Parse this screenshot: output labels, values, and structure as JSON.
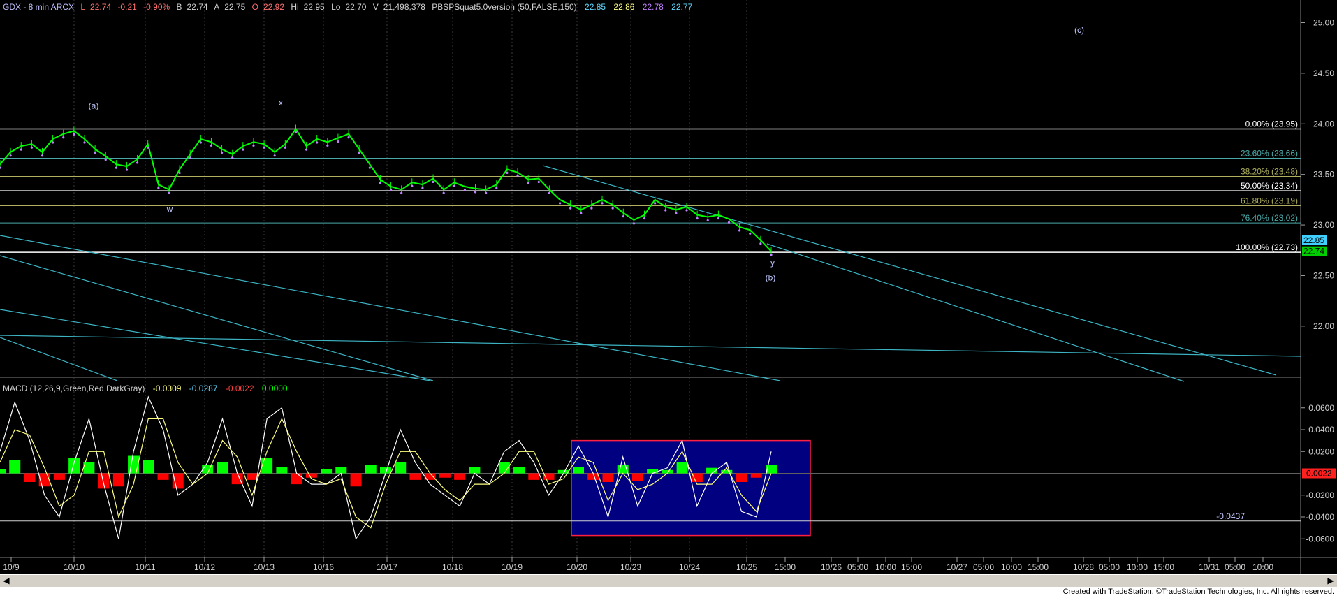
{
  "header": {
    "symbol_line": "GDX - 8 min  ARCX",
    "last": "L=22.74",
    "change": "-0.21",
    "change_pct": "-0.90%",
    "bid": "B=22.74",
    "ask": "A=22.75",
    "open": "O=22.92",
    "high": "Hi=22.95",
    "low": "Lo=22.70",
    "volume": "V=21,498,378",
    "study": "PBSPSquat5.0version (50,FALSE,150)",
    "study_values": [
      "22.85",
      "22.86",
      "22.78",
      "22.77"
    ]
  },
  "colors": {
    "background": "#000000",
    "price": "#00ff00",
    "trendline": "#3cb4c4",
    "fib_white": "#ffffff",
    "fib_teal": "#4aa8a8",
    "fib_olive": "#b0b060",
    "macd_line": "#ffffff",
    "signal_line": "#ffff80",
    "hist_pos": "#00ff00",
    "hist_neg": "#ff0000",
    "box_fill": "#000080",
    "box_border": "#ff2040"
  },
  "chart_data": [
    {
      "type": "line",
      "title": "GDX - 8 min",
      "ylim": [
        21.55,
        25.1
      ],
      "y_ticks": [
        "25.00",
        "24.50",
        "24.00",
        "23.50",
        "23.00",
        "22.50",
        "22.00"
      ],
      "y_tick_values": [
        25.0,
        24.5,
        24.0,
        23.5,
        23.0,
        22.5,
        22.0
      ],
      "x_labels": [
        "10/9",
        "10/10",
        "10/11",
        "10/12",
        "10/13",
        "10/16",
        "10/17",
        "10/18",
        "10/19",
        "10/20",
        "10/23",
        "10/24",
        "10/25",
        "15:00",
        "10/26",
        "05:00",
        "10:00",
        "15:00",
        "10/27",
        "05:00",
        "10:00",
        "15:00",
        "10/28",
        "05:00",
        "10:00",
        "15:00",
        "10/31",
        "05:00",
        "10:00"
      ],
      "series": [
        {
          "values": [
            23.6,
            23.72,
            23.78,
            23.8,
            23.72,
            23.85,
            23.9,
            23.93,
            23.85,
            23.75,
            23.68,
            23.6,
            23.58,
            23.65,
            23.8,
            23.4,
            23.35,
            23.55,
            23.7,
            23.85,
            23.82,
            23.75,
            23.7,
            23.78,
            23.82,
            23.8,
            23.72,
            23.8,
            23.95,
            23.78,
            23.85,
            23.82,
            23.86,
            23.9,
            23.75,
            23.6,
            23.45,
            23.38,
            23.35,
            23.42,
            23.4,
            23.46,
            23.35,
            23.42,
            23.38,
            23.36,
            23.35,
            23.4,
            23.55,
            23.52,
            23.45,
            23.46,
            23.35,
            23.25,
            23.2,
            23.15,
            23.2,
            23.25,
            23.2,
            23.12,
            23.05,
            23.1,
            23.25,
            23.18,
            23.15,
            23.18,
            23.1,
            23.08,
            23.1,
            23.06,
            22.98,
            22.95,
            22.85,
            22.74
          ]
        }
      ],
      "last_price_labels": [
        "22.85",
        "22.74"
      ],
      "fib_levels": [
        {
          "label": "0.00% (23.95)",
          "value": 23.95
        },
        {
          "label": "23.60% (23.66)",
          "value": 23.66
        },
        {
          "label": "38.20% (23.48)",
          "value": 23.48
        },
        {
          "label": "50.00% (23.34)",
          "value": 23.34
        },
        {
          "label": "61.80% (23.19)",
          "value": 23.19
        },
        {
          "label": "76.40% (23.02)",
          "value": 23.02
        },
        {
          "label": "100.00% (22.73)",
          "value": 22.73
        }
      ],
      "annotations": [
        "(a)",
        "x",
        "w",
        "y",
        "(b)",
        "(c)"
      ]
    },
    {
      "type": "area",
      "title": "MACD (12,26,9,Green,Red,DarkGray)",
      "legend_values": [
        "-0.0309",
        "-0.0287",
        "-0.0022",
        "0.0000"
      ],
      "ylim": [
        -0.072,
        0.072
      ],
      "y_ticks": [
        "0.0600",
        "0.0400",
        "0.0200",
        "-0.0200",
        "-0.0400",
        "-0.0600"
      ],
      "y_tick_values": [
        0.06,
        0.04,
        0.02,
        -0.02,
        -0.04,
        -0.06
      ],
      "zero_label": "-0.0022",
      "reference_line_label": "-0.0437",
      "reference_value": -0.0437,
      "macd": [
        0.02,
        0.065,
        0.03,
        -0.02,
        -0.04,
        0.01,
        0.05,
        -0.01,
        -0.06,
        0.02,
        0.07,
        0.04,
        -0.02,
        -0.01,
        0.01,
        0.05,
        0.0,
        -0.03,
        0.05,
        0.06,
        0.0,
        -0.01,
        -0.01,
        0.0,
        -0.06,
        -0.04,
        0.0,
        0.04,
        0.01,
        -0.01,
        -0.02,
        -0.03,
        0.0,
        -0.01,
        0.02,
        0.03,
        0.01,
        -0.02,
        0.0,
        0.025,
        0.0,
        -0.04,
        0.015,
        -0.03,
        0.0,
        0.005,
        0.03,
        -0.03,
        0.0,
        0.01,
        -0.035,
        -0.04,
        0.02
      ],
      "signal": [
        0.01,
        0.04,
        0.035,
        0.005,
        -0.03,
        -0.02,
        0.02,
        0.02,
        -0.04,
        -0.01,
        0.05,
        0.05,
        0.01,
        -0.01,
        0.0,
        0.03,
        0.015,
        -0.02,
        0.02,
        0.05,
        0.02,
        -0.005,
        -0.01,
        -0.005,
        -0.04,
        -0.05,
        -0.01,
        0.02,
        0.02,
        0.0,
        -0.015,
        -0.025,
        -0.01,
        -0.01,
        0.0,
        0.02,
        0.02,
        -0.01,
        -0.005,
        0.015,
        0.01,
        -0.025,
        0.0,
        -0.015,
        -0.01,
        0.0,
        0.02,
        -0.01,
        -0.01,
        0.005,
        -0.02,
        -0.035,
        0.0
      ],
      "histogram": [
        0.004,
        0.012,
        -0.008,
        -0.012,
        -0.006,
        0.014,
        0.01,
        -0.014,
        -0.012,
        0.016,
        0.012,
        -0.006,
        -0.014,
        0.0,
        0.008,
        0.01,
        -0.01,
        -0.006,
        0.014,
        0.006,
        -0.01,
        -0.004,
        0.004,
        0.006,
        -0.012,
        0.008,
        0.006,
        0.01,
        -0.006,
        -0.006,
        -0.004,
        -0.006,
        0.006,
        0.0,
        0.01,
        0.006,
        -0.006,
        -0.006,
        0.003,
        0.006,
        -0.006,
        -0.008,
        0.008,
        -0.007,
        0.004,
        0.003,
        0.01,
        -0.008,
        0.005,
        0.003,
        -0.008,
        -0.004,
        0.008
      ]
    }
  ],
  "scrollbar": {
    "left_arrow": "◀",
    "right_arrow": "▶"
  },
  "footer": {
    "text": "Created with TradeStation. ©TradeStation Technologies, Inc. All rights reserved."
  }
}
